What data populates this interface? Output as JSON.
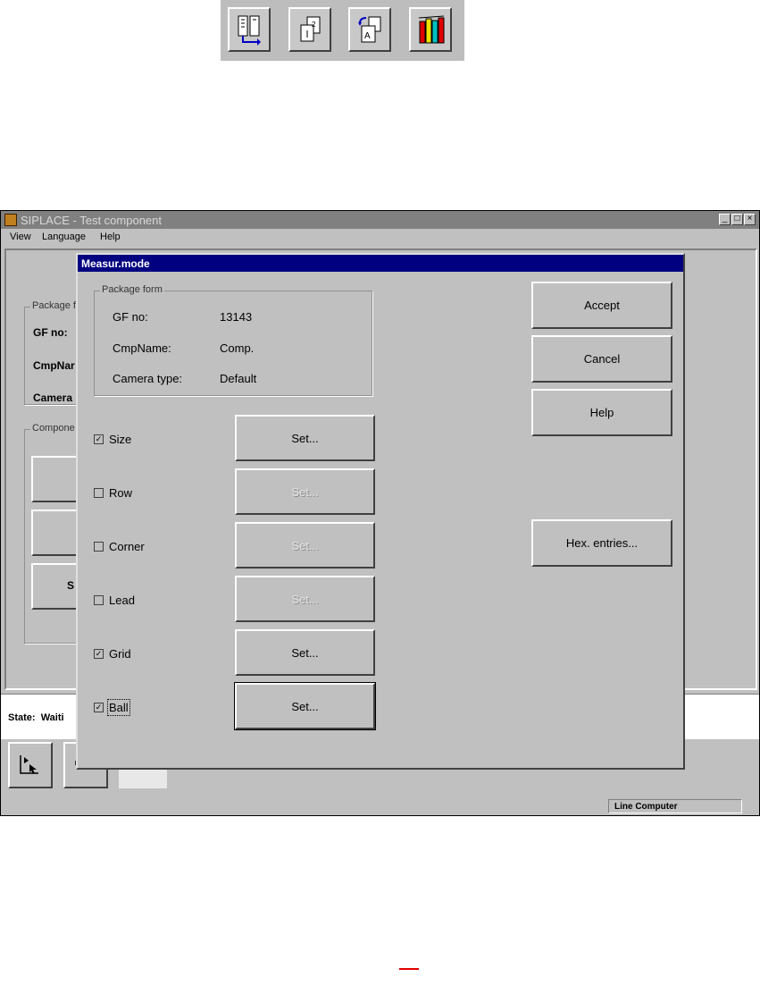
{
  "window": {
    "title": "SIPLACE - Test component",
    "menu": [
      "View",
      "Language",
      "Help"
    ]
  },
  "background": {
    "package_group_label": "Package f",
    "gf_label": "GF no:",
    "cmpname_label": "CmpNar",
    "camera_label": "Camera",
    "component_group_label": "Compone",
    "s_button_label": "S",
    "state_label": "State:",
    "state_value": "Waiti"
  },
  "statusbar": {
    "line_computer": "Line Computer"
  },
  "dialog": {
    "title": "Measur.mode",
    "package_form": {
      "label": "Package form",
      "rows": [
        {
          "label": "GF no:",
          "value": "13143"
        },
        {
          "label": "CmpName:",
          "value": "Comp."
        },
        {
          "label": "Camera type:",
          "value": "Default"
        }
      ]
    },
    "modes": [
      {
        "label": "Size",
        "checked": true,
        "button": "Set...",
        "enabled": true
      },
      {
        "label": "Row",
        "checked": false,
        "button": "Set...",
        "enabled": false
      },
      {
        "label": "Corner",
        "checked": false,
        "button": "Set...",
        "enabled": false
      },
      {
        "label": "Lead",
        "checked": false,
        "button": "Set...",
        "enabled": false
      },
      {
        "label": "Grid",
        "checked": true,
        "button": "Set...",
        "enabled": true
      },
      {
        "label": "Ball",
        "checked": true,
        "button": "Set...",
        "enabled": true
      }
    ],
    "buttons": {
      "accept": "Accept",
      "cancel": "Cancel",
      "help": "Help",
      "hex_entries": "Hex. entries..."
    }
  },
  "icons": [
    "layout-icon",
    "copy-page-icon",
    "rotate-document-icon",
    "library-books-icon",
    "app-icon",
    "cursor-icon",
    "tool-icon"
  ]
}
